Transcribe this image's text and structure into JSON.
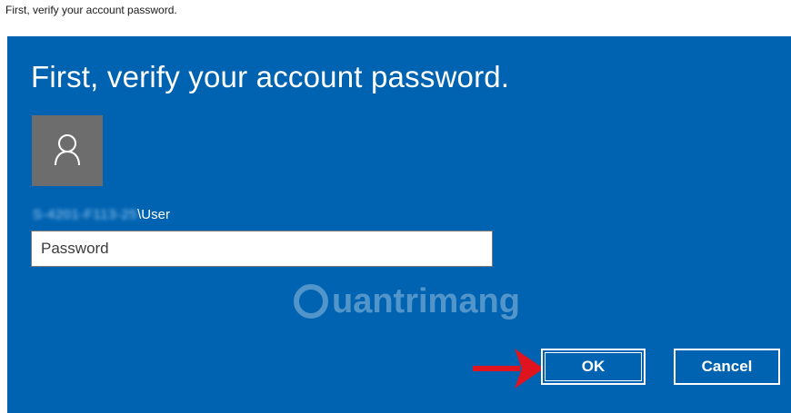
{
  "window": {
    "title": "First, verify your account password."
  },
  "dialog": {
    "heading": "First, verify your account password.",
    "avatar_icon": "user-icon",
    "account": {
      "prefix_blurred": "S-4201-F113-25",
      "suffix": "\\User"
    },
    "password": {
      "value": "",
      "placeholder": "Password"
    },
    "buttons": {
      "ok_label": "OK",
      "cancel_label": "Cancel"
    },
    "watermark": "uantrimang",
    "colors": {
      "background": "#0063b1",
      "avatar": "#6d6d6d",
      "arrow": "#e0141e"
    }
  }
}
